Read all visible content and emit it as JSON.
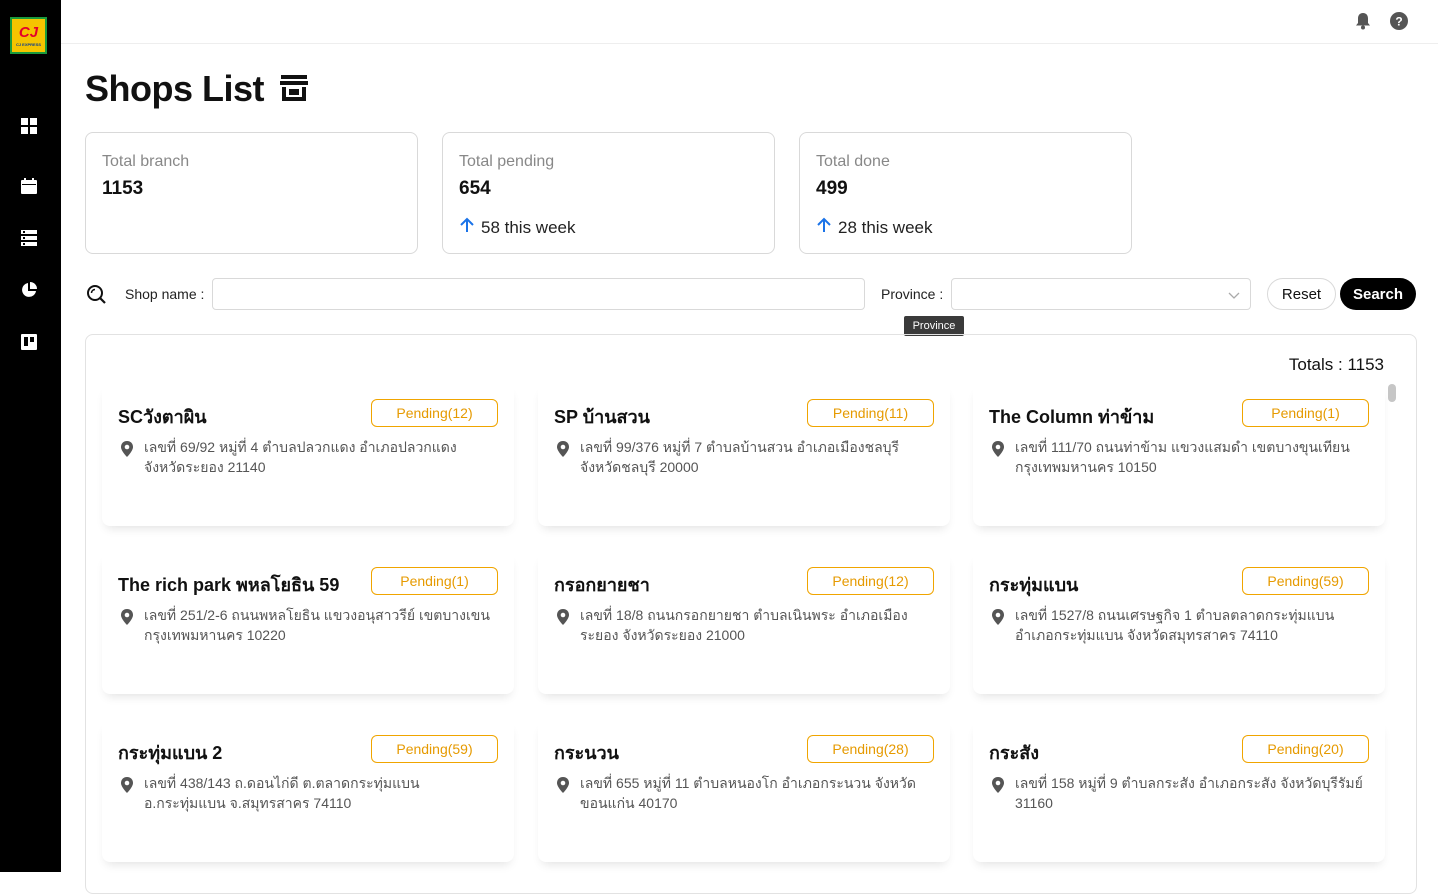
{
  "logo": {
    "mark": "CJ",
    "sub": "CJ EXPRESS"
  },
  "page": {
    "title": "Shops List"
  },
  "stats": [
    {
      "label": "Total branch",
      "value": "1153",
      "trend": ""
    },
    {
      "label": "Total pending",
      "value": "654",
      "trend": "58 this week"
    },
    {
      "label": "Total done",
      "value": "499",
      "trend": "28 this week"
    }
  ],
  "filters": {
    "shop_name_label": "Shop name :",
    "shop_name_value": "",
    "province_label": "Province :",
    "province_value": "",
    "province_tooltip": "Province",
    "reset_label": "Reset",
    "search_label": "Search"
  },
  "list": {
    "totals": "Totals : 1153"
  },
  "shops": [
    {
      "name": "SCวังตาผิน",
      "status": "Pending(12)",
      "address": "เลขที่ 69/92 หมู่ที่ 4 ตำบลปลวกแดง อำเภอปลวกแดง จังหวัดระยอง 21140"
    },
    {
      "name": "SP บ้านสวน",
      "status": "Pending(11)",
      "address": "เลขที่ 99/376 หมู่ที่ 7 ตำบลบ้านสวน อำเภอเมืองชลบุรี จังหวัดชลบุรี 20000"
    },
    {
      "name": "The Column ท่าข้าม",
      "status": "Pending(1)",
      "address": "เลขที่ 111/70 ถนนท่าข้าม แขวงแสมดำ เขตบางขุนเทียน กรุงเทพมหานคร 10150"
    },
    {
      "name": "The rich park พหลโยธิน 59",
      "status": "Pending(1)",
      "address": "เลขที่ 251/2-6 ถนนพหลโยธิน แขวงอนุสาวรีย์ เขตบางเขน กรุงเทพมหานคร 10220"
    },
    {
      "name": "กรอกยายชา",
      "status": "Pending(12)",
      "address": "เลขที่ 18/8 ถนนกรอกยายชา ตำบลเนินพระ อำเภอเมืองระยอง จังหวัดระยอง 21000"
    },
    {
      "name": "กระทุ่มแบน",
      "status": "Pending(59)",
      "address": "เลขที่ 1527/8 ถนนเศรษฐกิจ 1 ตำบลตลาดกระทุ่มแบน อำเภอกระทุ่มแบน จังหวัดสมุทรสาคร 74110"
    },
    {
      "name": "กระทุ่มแบน 2",
      "status": "Pending(59)",
      "address": "เลขที่ 438/143 ถ.ดอนไก่ดี ต.ตลาดกระทุ่มแบน อ.กระทุ่มแบน จ.สมุทรสาคร 74110"
    },
    {
      "name": "กระนวน",
      "status": "Pending(28)",
      "address": "เลขที่ 655 หมู่ที่ 11 ตำบลหนองโก อำเภอกระนวน จังหวัดขอนแก่น 40170"
    },
    {
      "name": "กระสัง",
      "status": "Pending(20)",
      "address": "เลขที่ 158 หมู่ที่ 9 ตำบลกระสัง อำเภอกระสัง จังหวัดบุรีรัมย์ 31160"
    }
  ]
}
